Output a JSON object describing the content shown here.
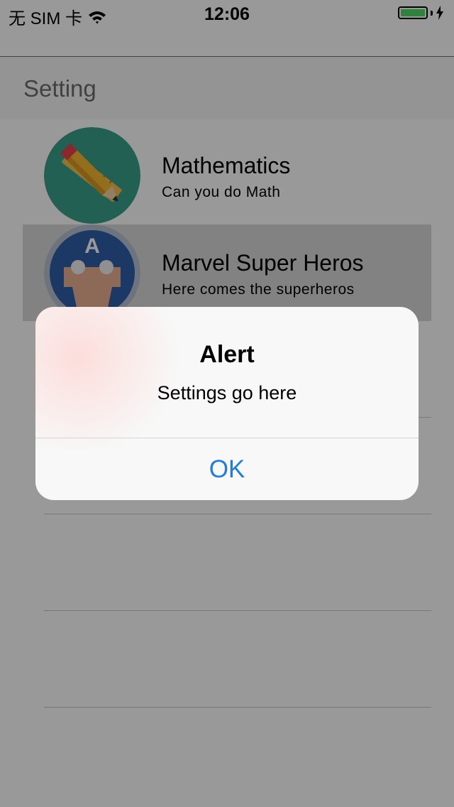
{
  "status_bar": {
    "carrier": "无 SIM 卡",
    "time": "12:06",
    "battery_level": 1.0,
    "battery_color": "#4cd964",
    "icons": [
      "wifi-icon",
      "battery-icon",
      "charging-bolt-icon"
    ]
  },
  "page": {
    "title": "Setting"
  },
  "list": {
    "items": [
      {
        "title": "Mathematics",
        "subtitle": "Can you do Math",
        "icon": "ruler-pencil-icon",
        "selected": false
      },
      {
        "title": "Marvel Super Heros",
        "subtitle": "Here comes the superheros",
        "icon": "captain-america-icon",
        "selected": true
      }
    ]
  },
  "alert": {
    "title": "Alert",
    "message": "Settings go here",
    "ok_label": "OK",
    "button_color": "#1a7ee6"
  }
}
